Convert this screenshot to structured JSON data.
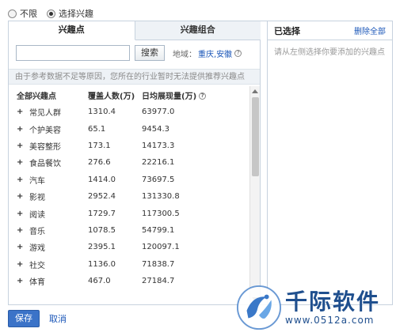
{
  "scope": {
    "options": [
      {
        "label": "不限",
        "checked": false
      },
      {
        "label": "选择兴趣",
        "checked": true
      }
    ]
  },
  "tabs": [
    {
      "label": "兴趣点",
      "active": true
    },
    {
      "label": "兴趣组合",
      "active": false
    }
  ],
  "search": {
    "value": "",
    "placeholder": "",
    "button_label": "搜索",
    "region_label": "地域：",
    "region_value": "重庆,安徽"
  },
  "notice": "由于参考数据不足等原因，您所在的行业暂时无法提供推荐兴趣点",
  "table": {
    "headers": [
      "全部兴趣点",
      "覆盖人数(万)",
      "日均展现量(万)"
    ],
    "rows": [
      {
        "name": "常见人群",
        "coverage": "1310.4",
        "impressions": "63977.0"
      },
      {
        "name": "个护美容",
        "coverage": "65.1",
        "impressions": "9454.3"
      },
      {
        "name": "美容整形",
        "coverage": "173.1",
        "impressions": "14173.3"
      },
      {
        "name": "食品餐饮",
        "coverage": "276.6",
        "impressions": "22216.1"
      },
      {
        "name": "汽车",
        "coverage": "1414.0",
        "impressions": "73697.5"
      },
      {
        "name": "影视",
        "coverage": "2952.4",
        "impressions": "131330.8"
      },
      {
        "name": "阅读",
        "coverage": "1729.7",
        "impressions": "117300.5"
      },
      {
        "name": "音乐",
        "coverage": "1078.5",
        "impressions": "54799.1"
      },
      {
        "name": "游戏",
        "coverage": "2395.1",
        "impressions": "120097.1"
      },
      {
        "name": "社交",
        "coverage": "1136.0",
        "impressions": "71838.7"
      },
      {
        "name": "体育",
        "coverage": "467.0",
        "impressions": "27184.7"
      }
    ]
  },
  "selected": {
    "title": "已选择",
    "delete_all": "删除全部",
    "hint": "请从左侧选择你要添加的兴趣点"
  },
  "actions": {
    "save": "保存",
    "cancel": "取消"
  },
  "watermark": {
    "title": "千际软件",
    "url": "www.0512a.com"
  },
  "colors": {
    "link": "#1a56b8",
    "primary_button": "#3b73c8",
    "border": "#c7d2de",
    "watermark": "#1f4f8e"
  }
}
